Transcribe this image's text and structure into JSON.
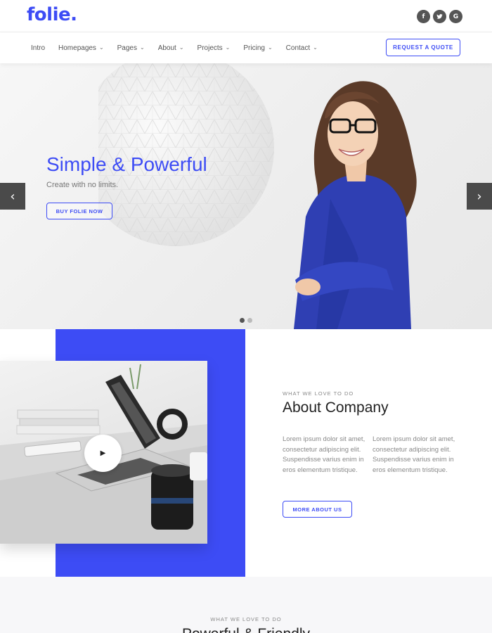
{
  "brand": {
    "logo": "folie."
  },
  "socials": [
    {
      "label": "f",
      "icon": "facebook-icon"
    },
    {
      "label": "t",
      "icon": "twitter-icon"
    },
    {
      "label": "G",
      "icon": "google-icon"
    }
  ],
  "nav": {
    "items": [
      {
        "label": "Intro",
        "dropdown": false
      },
      {
        "label": "Homepages",
        "dropdown": true
      },
      {
        "label": "Pages",
        "dropdown": true
      },
      {
        "label": "About",
        "dropdown": true
      },
      {
        "label": "Projects",
        "dropdown": true
      },
      {
        "label": "Pricing",
        "dropdown": true
      },
      {
        "label": "Contact",
        "dropdown": true
      }
    ],
    "cta": "REQUEST A QUOTE"
  },
  "hero": {
    "title": "Simple & Powerful",
    "subtitle": "Create with no limits.",
    "button": "BUY FOLIE NOW",
    "prev_arrow": "‹",
    "next_arrow": "›",
    "slides_total": 2,
    "active_slide": 1
  },
  "about": {
    "kicker": "WHAT WE LOVE TO DO",
    "title": "About Company",
    "paragraph_1": "Lorem ipsum dolor sit amet, consectetur adipiscing elit. Suspendisse varius enim in eros elementum tristique.",
    "paragraph_2": "Lorem ipsum dolor sit amet, consectetur adipiscing elit. Suspendisse varius enim in eros elementum tristique.",
    "button": "MORE ABOUT US",
    "play_symbol": "▶"
  },
  "next_section": {
    "kicker": "WHAT WE LOVE TO DO",
    "title": "Powerful & Friendly"
  },
  "colors": {
    "accent": "#3d4cf5",
    "dark": "#4a4a4a"
  }
}
